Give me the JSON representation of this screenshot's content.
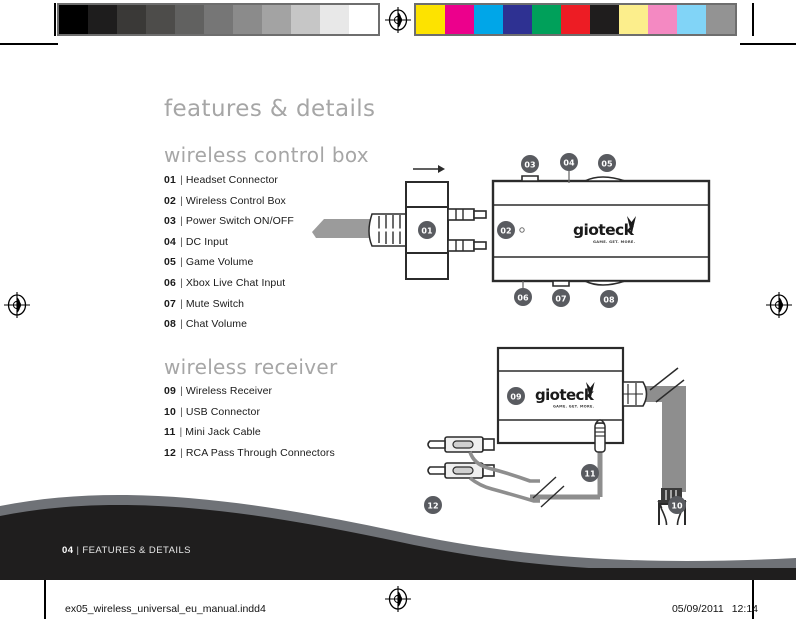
{
  "page": {
    "heading": "features & details",
    "section_one": {
      "title": "wireless control box",
      "items": [
        {
          "num": "01",
          "sep": "|",
          "label": "Headset Connector"
        },
        {
          "num": "02",
          "sep": "|",
          "label": "Wireless Control Box"
        },
        {
          "num": "03",
          "sep": "|",
          "label": "Power Switch ON/OFF"
        },
        {
          "num": "04",
          "sep": "|",
          "label": "DC Input"
        },
        {
          "num": "05",
          "sep": "|",
          "label": "Game Volume"
        },
        {
          "num": "06",
          "sep": "|",
          "label": "Xbox Live Chat Input"
        },
        {
          "num": "07",
          "sep": "|",
          "label": "Mute Switch"
        },
        {
          "num": "08",
          "sep": "|",
          "label": "Chat Volume"
        }
      ]
    },
    "section_two": {
      "title": "wireless receiver",
      "items": [
        {
          "num": "09",
          "sep": "|",
          "label": "Wireless Receiver"
        },
        {
          "num": "10",
          "sep": "|",
          "label": "USB Connector"
        },
        {
          "num": "11",
          "sep": "|",
          "label": "Mini Jack Cable"
        },
        {
          "num": "12",
          "sep": "|",
          "label": "RCA Pass Through Connectors"
        }
      ]
    },
    "footer": {
      "page_number": "04",
      "separator": "|",
      "section_name": "FEATURES & DETAILS"
    }
  },
  "diagram_control_box": {
    "brand": "gioteck",
    "brand_tagline": "GAME. GET. MORE.",
    "callouts": {
      "c01": "01",
      "c02": "02",
      "c03": "03",
      "c04": "04",
      "c05": "05",
      "c06": "06",
      "c07": "07",
      "c08": "08"
    }
  },
  "diagram_receiver": {
    "brand": "gioteck",
    "brand_tagline": "GAME. GET. MORE.",
    "callouts": {
      "c09": "09",
      "c10": "10",
      "c11": "11",
      "c12": "12"
    }
  },
  "print_strip": {
    "file_name": "ex05_wireless_universal_eu_manual.indd",
    "sheet_number": "4",
    "date": "05/09/2011",
    "time": "12:14"
  },
  "calibration": {
    "grays": [
      "#000000",
      "#1e1d1d",
      "#3a3937",
      "#4d4c4a",
      "#616160",
      "#767676",
      "#8b8b8b",
      "#a3a3a3",
      "#c6c6c6",
      "#e8e8e8",
      "#ffffff"
    ],
    "colors": [
      "#fde300",
      "#ec008c",
      "#00a6e8",
      "#2e3192",
      "#00a05a",
      "#ed1c24",
      "#1f1d1d",
      "#fcee8c",
      "#f489c2",
      "#81d4f7",
      "#939393"
    ]
  }
}
